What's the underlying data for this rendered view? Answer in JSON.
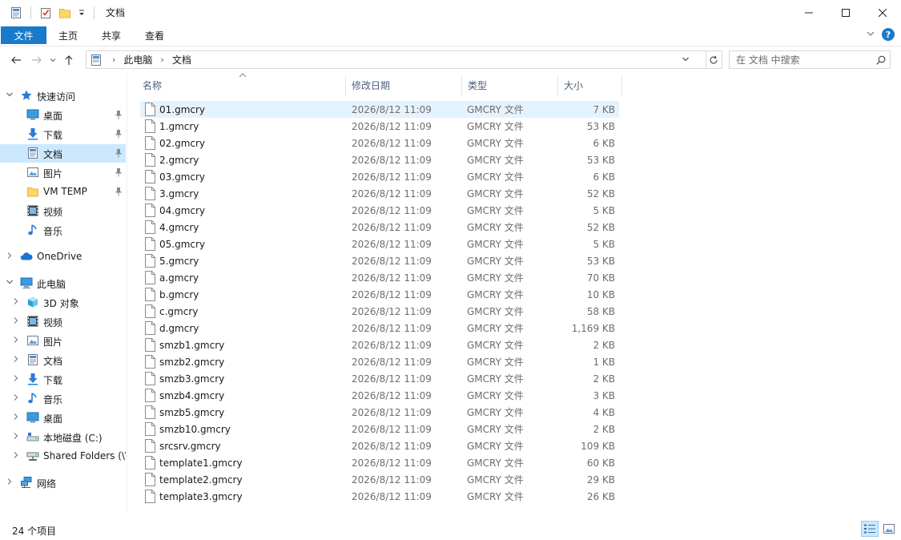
{
  "window": {
    "title": "文档"
  },
  "ribbon": {
    "tabs": [
      {
        "label": "文件",
        "active": true
      },
      {
        "label": "主页",
        "active": false
      },
      {
        "label": "共享",
        "active": false
      },
      {
        "label": "查看",
        "active": false
      }
    ],
    "help": "?"
  },
  "address": {
    "crumbs": [
      "此电脑",
      "文档"
    ]
  },
  "search": {
    "placeholder": "在 文档 中搜索"
  },
  "sidebar": {
    "items": [
      {
        "label": "快速访问",
        "icon": "star-icon",
        "level": 0,
        "chevron": "expanded",
        "pinned": false,
        "selected": false
      },
      {
        "label": "桌面",
        "icon": "desktop-icon",
        "level": 1,
        "chevron": "none",
        "pinned": true,
        "selected": false
      },
      {
        "label": "下载",
        "icon": "download-icon",
        "level": 1,
        "chevron": "none",
        "pinned": true,
        "selected": false
      },
      {
        "label": "文档",
        "icon": "document-icon",
        "level": 1,
        "chevron": "none",
        "pinned": true,
        "selected": true
      },
      {
        "label": "图片",
        "icon": "pictures-icon",
        "level": 1,
        "chevron": "none",
        "pinned": true,
        "selected": false
      },
      {
        "label": "VM TEMP",
        "icon": "folder-icon",
        "level": 1,
        "chevron": "none",
        "pinned": true,
        "selected": false
      },
      {
        "label": "视频",
        "icon": "video-icon",
        "level": 1,
        "chevron": "none",
        "pinned": false,
        "selected": false
      },
      {
        "label": "音乐",
        "icon": "music-icon",
        "level": 1,
        "chevron": "none",
        "pinned": false,
        "selected": false
      },
      {
        "label": "OneDrive",
        "icon": "onedrive-icon",
        "level": 0,
        "chevron": "collapsed",
        "pinned": false,
        "selected": false,
        "gap": true
      },
      {
        "label": "此电脑",
        "icon": "pc-icon",
        "level": 0,
        "chevron": "expanded",
        "pinned": false,
        "selected": false,
        "gap": true
      },
      {
        "label": "3D 对象",
        "icon": "3d-objects-icon",
        "level": 1,
        "chevron": "collapsed",
        "pinned": false,
        "selected": false
      },
      {
        "label": "视频",
        "icon": "video-icon",
        "level": 1,
        "chevron": "collapsed",
        "pinned": false,
        "selected": false
      },
      {
        "label": "图片",
        "icon": "pictures-icon",
        "level": 1,
        "chevron": "collapsed",
        "pinned": false,
        "selected": false
      },
      {
        "label": "文档",
        "icon": "document-icon",
        "level": 1,
        "chevron": "collapsed",
        "pinned": false,
        "selected": false
      },
      {
        "label": "下载",
        "icon": "download-icon",
        "level": 1,
        "chevron": "collapsed",
        "pinned": false,
        "selected": false
      },
      {
        "label": "音乐",
        "icon": "music-icon",
        "level": 1,
        "chevron": "collapsed",
        "pinned": false,
        "selected": false
      },
      {
        "label": "桌面",
        "icon": "desktop-icon",
        "level": 1,
        "chevron": "collapsed",
        "pinned": false,
        "selected": false
      },
      {
        "label": "本地磁盘 (C:)",
        "icon": "drive-icon",
        "level": 1,
        "chevron": "collapsed",
        "pinned": false,
        "selected": false
      },
      {
        "label": "Shared Folders (\\\\",
        "icon": "network-drive-icon",
        "level": 1,
        "chevron": "collapsed",
        "pinned": false,
        "selected": false
      },
      {
        "label": "网络",
        "icon": "network-icon",
        "level": 0,
        "chevron": "collapsed",
        "pinned": false,
        "selected": false,
        "gap": true
      }
    ]
  },
  "columns": {
    "name": "名称",
    "date": "修改日期",
    "type": "类型",
    "size": "大小"
  },
  "files": [
    {
      "name": "01.gmcry",
      "date": "2026/8/12 11:09",
      "type": "GMCRY 文件",
      "size": "7 KB",
      "selected": true
    },
    {
      "name": "1.gmcry",
      "date": "2026/8/12 11:09",
      "type": "GMCRY 文件",
      "size": "53 KB"
    },
    {
      "name": "02.gmcry",
      "date": "2026/8/12 11:09",
      "type": "GMCRY 文件",
      "size": "6 KB"
    },
    {
      "name": "2.gmcry",
      "date": "2026/8/12 11:09",
      "type": "GMCRY 文件",
      "size": "53 KB"
    },
    {
      "name": "03.gmcry",
      "date": "2026/8/12 11:09",
      "type": "GMCRY 文件",
      "size": "6 KB"
    },
    {
      "name": "3.gmcry",
      "date": "2026/8/12 11:09",
      "type": "GMCRY 文件",
      "size": "52 KB"
    },
    {
      "name": "04.gmcry",
      "date": "2026/8/12 11:09",
      "type": "GMCRY 文件",
      "size": "5 KB"
    },
    {
      "name": "4.gmcry",
      "date": "2026/8/12 11:09",
      "type": "GMCRY 文件",
      "size": "52 KB"
    },
    {
      "name": "05.gmcry",
      "date": "2026/8/12 11:09",
      "type": "GMCRY 文件",
      "size": "5 KB"
    },
    {
      "name": "5.gmcry",
      "date": "2026/8/12 11:09",
      "type": "GMCRY 文件",
      "size": "53 KB"
    },
    {
      "name": "a.gmcry",
      "date": "2026/8/12 11:09",
      "type": "GMCRY 文件",
      "size": "70 KB"
    },
    {
      "name": "b.gmcry",
      "date": "2026/8/12 11:09",
      "type": "GMCRY 文件",
      "size": "10 KB"
    },
    {
      "name": "c.gmcry",
      "date": "2026/8/12 11:09",
      "type": "GMCRY 文件",
      "size": "58 KB"
    },
    {
      "name": "d.gmcry",
      "date": "2026/8/12 11:09",
      "type": "GMCRY 文件",
      "size": "1,169 KB"
    },
    {
      "name": "smzb1.gmcry",
      "date": "2026/8/12 11:09",
      "type": "GMCRY 文件",
      "size": "2 KB"
    },
    {
      "name": "smzb2.gmcry",
      "date": "2026/8/12 11:09",
      "type": "GMCRY 文件",
      "size": "1 KB"
    },
    {
      "name": "smzb3.gmcry",
      "date": "2026/8/12 11:09",
      "type": "GMCRY 文件",
      "size": "2 KB"
    },
    {
      "name": "smzb4.gmcry",
      "date": "2026/8/12 11:09",
      "type": "GMCRY 文件",
      "size": "3 KB"
    },
    {
      "name": "smzb5.gmcry",
      "date": "2026/8/12 11:09",
      "type": "GMCRY 文件",
      "size": "4 KB"
    },
    {
      "name": "smzb10.gmcry",
      "date": "2026/8/12 11:09",
      "type": "GMCRY 文件",
      "size": "2 KB"
    },
    {
      "name": "srcsrv.gmcry",
      "date": "2026/8/12 11:09",
      "type": "GMCRY 文件",
      "size": "109 KB"
    },
    {
      "name": "template1.gmcry",
      "date": "2026/8/12 11:09",
      "type": "GMCRY 文件",
      "size": "60 KB"
    },
    {
      "name": "template2.gmcry",
      "date": "2026/8/12 11:09",
      "type": "GMCRY 文件",
      "size": "29 KB"
    },
    {
      "name": "template3.gmcry",
      "date": "2026/8/12 11:09",
      "type": "GMCRY 文件",
      "size": "26 KB"
    }
  ],
  "status": {
    "item_count": "24 个项目"
  },
  "colors": {
    "accent": "#1979ca",
    "selection": "#cce8ff",
    "row_selection": "#e5f3ff",
    "header_text": "#4c607a",
    "muted_text": "#6d6d6d"
  }
}
